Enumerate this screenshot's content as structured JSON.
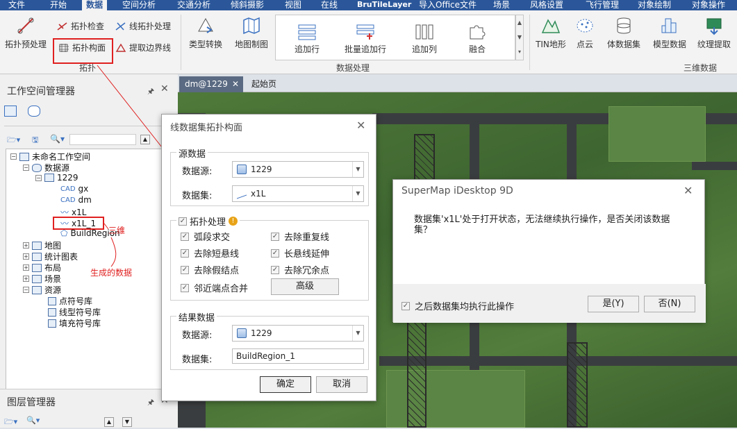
{
  "menubar": {
    "items": [
      "文件",
      "开始",
      "数据",
      "空间分析",
      "交通分析",
      "倾斜摄影",
      "视图",
      "在线",
      "BruTileLayer",
      "导入Office文件",
      "场景",
      "风格设置",
      "飞行管理",
      "对象绘制",
      "对象操作"
    ],
    "active": "数据"
  },
  "ribbon": {
    "topo_pre": "拓扑预处理",
    "topo_check": "拓扑检查",
    "line_topo": "线拓扑处理",
    "topo_polygon": "拓扑构面",
    "extract_boundary": "提取边界线",
    "group_topo": "拓扑",
    "type_convert": "类型转换",
    "map_cartography": "地图制图",
    "gallery": [
      "追加行",
      "批量追加行",
      "追加列",
      "融合"
    ],
    "group_data": "数据处理",
    "tin": "TIN地形",
    "point_cloud": "点云",
    "volume_dataset": "体数据集",
    "model_data": "模型数据",
    "texture_extract": "纹理提取",
    "group_3d": "三维数据"
  },
  "workspace_panel": {
    "title": "工作空间管理器",
    "tree": {
      "workspace": "未命名工作空间",
      "datasources": "数据源",
      "ds_1229": "1229",
      "gx": "gx",
      "dm": "dm",
      "x1L": "x1L",
      "x1L_1": "x1L_1",
      "buildregion": "BuildRegion",
      "maps": "地图",
      "charts": "统计图表",
      "layouts": "布局",
      "scenes": "场景",
      "resources": "资源",
      "point_symbols": "点符号库",
      "line_symbols": "线型符号库",
      "fill_symbols": "填充符号库"
    },
    "annotation_3d": "三维",
    "annotation_generated": "生成的数据"
  },
  "layer_panel": {
    "title": "图层管理器"
  },
  "doc_tabs": [
    "dm@1229",
    "起始页"
  ],
  "topo_dialog": {
    "title": "线数据集拓扑构面",
    "source_group": "源数据",
    "datasource_label": "数据源:",
    "datasource_value": "1229",
    "dataset_label": "数据集:",
    "dataset_value": "x1L",
    "topo_group": "拓扑处理",
    "topo_group_checked": true,
    "options": [
      {
        "label": "弧段求交",
        "checked": true
      },
      {
        "label": "去除重复线",
        "checked": true
      },
      {
        "label": "去除短悬线",
        "checked": true
      },
      {
        "label": "长悬线延伸",
        "checked": true
      },
      {
        "label": "去除假结点",
        "checked": true
      },
      {
        "label": "去除冗余点",
        "checked": true
      },
      {
        "label": "邻近端点合并",
        "checked": true
      }
    ],
    "advanced": "高级",
    "result_group": "结果数据",
    "result_datasource_label": "数据源:",
    "result_datasource_value": "1229",
    "result_dataset_label": "数据集:",
    "result_dataset_value": "BuildRegion_1",
    "ok": "确定",
    "cancel": "取消"
  },
  "confirm_dialog": {
    "title": "SuperMap iDesktop 9D",
    "message": "数据集'x1L'处于打开状态，无法继续执行操作，是否关闭该数据集？",
    "apply_all": "之后数据集均执行此操作",
    "apply_all_checked": true,
    "yes": "是(Y)",
    "no": "否(N)"
  }
}
